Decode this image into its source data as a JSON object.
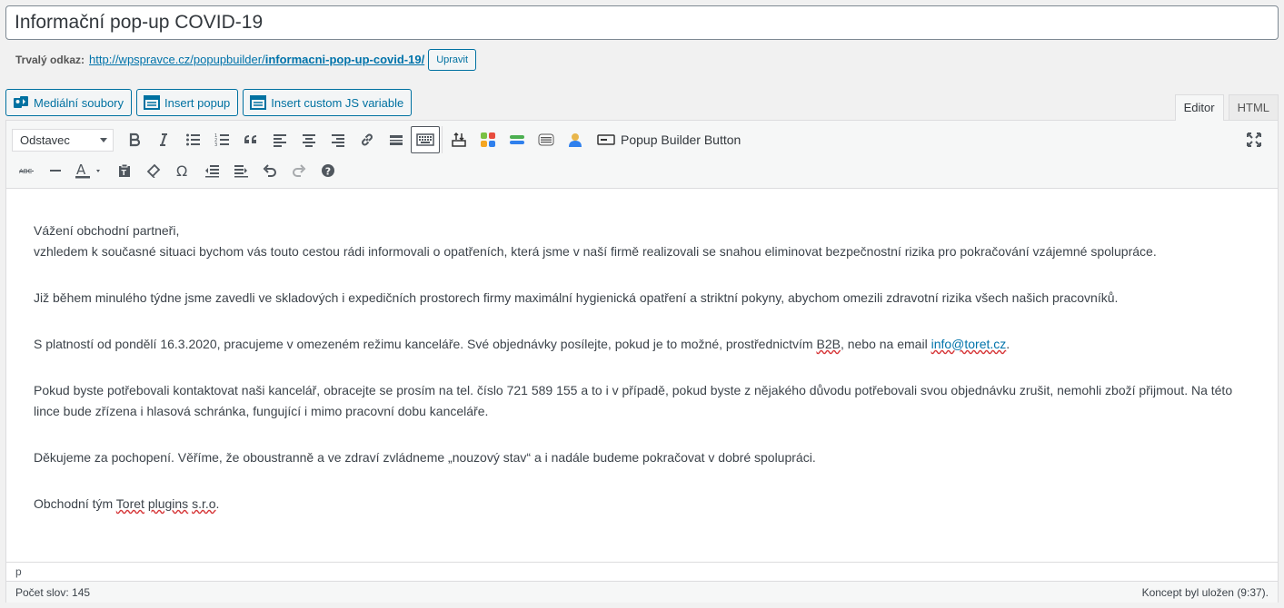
{
  "post_title": "Informační pop-up COVID-19",
  "permalink": {
    "label": "Trvalý odkaz:",
    "base_url": "http://wpspravce.cz/popupbuilder/",
    "slug": "informacni-pop-up-covid-19/",
    "edit_button": "Upravit"
  },
  "media_buttons": [
    {
      "label": "Mediální soubory",
      "icon": "media-icon"
    },
    {
      "label": "Insert popup",
      "icon": "popup-table-icon"
    },
    {
      "label": "Insert custom JS variable",
      "icon": "popup-table-icon"
    }
  ],
  "editor_tabs": {
    "visual": "Editor",
    "text": "HTML"
  },
  "toolbar": {
    "format_select": "Odstavec",
    "popup_builder_button": "Popup Builder Button"
  },
  "content": {
    "greeting": "Vážení obchodní partneři,",
    "p1": "vzhledem k současné situaci bychom vás touto cestou rádi informovali o opatřeních, která jsme v naší firmě realizovali se snahou eliminovat bezpečnostní rizika pro pokračování vzájemné spolupráce.",
    "p2": "Již během minulého týdne jsme zavedli ve skladových i expedičních prostorech firmy maximální hygienická opatření a striktní pokyny, abychom omezili zdravotní rizika všech našich pracovníků.",
    "p3_before": "S platností od pondělí 16.3.2020, pracujeme v omezeném režimu kanceláře. Své objednávky posílejte, pokud je to možné, prostřednictvím ",
    "p3_b2b": "B2B",
    "p3_mid": ", nebo na email ",
    "p3_email": "info@toret.cz",
    "p3_end": ".",
    "p4": "Pokud byste potřebovali kontaktovat naši kancelář, obracejte se prosím na tel. číslo 721 589 155 a to i v případě, pokud byste z nějakého důvodu potřebovali svou objednávku zrušit, nemohli zboží přijmout. Na této lince bude zřízena i hlasová schránka, fungující i mimo pracovní dobu kanceláře.",
    "p5": "Děkujeme za pochopení. Věříme, že oboustranně a ve zdraví zvládneme „nouzový stav“ a i nadále budeme pokračovat v dobré spolupráci.",
    "sign_before": "Obchodní tým ",
    "sign_toret": "Toret",
    "sign_space1": " ",
    "sign_plugins": "plugins",
    "sign_space2": " ",
    "sign_sro": "s.r.o",
    "sign_end": "."
  },
  "path": "p",
  "status": {
    "word_count": "Počet slov: 145",
    "draft_saved": "Koncept byl uložen (9:37)."
  },
  "colors": {
    "accent": "#0071a1",
    "link": "#0073aa",
    "spellcheck": "#d63638"
  }
}
